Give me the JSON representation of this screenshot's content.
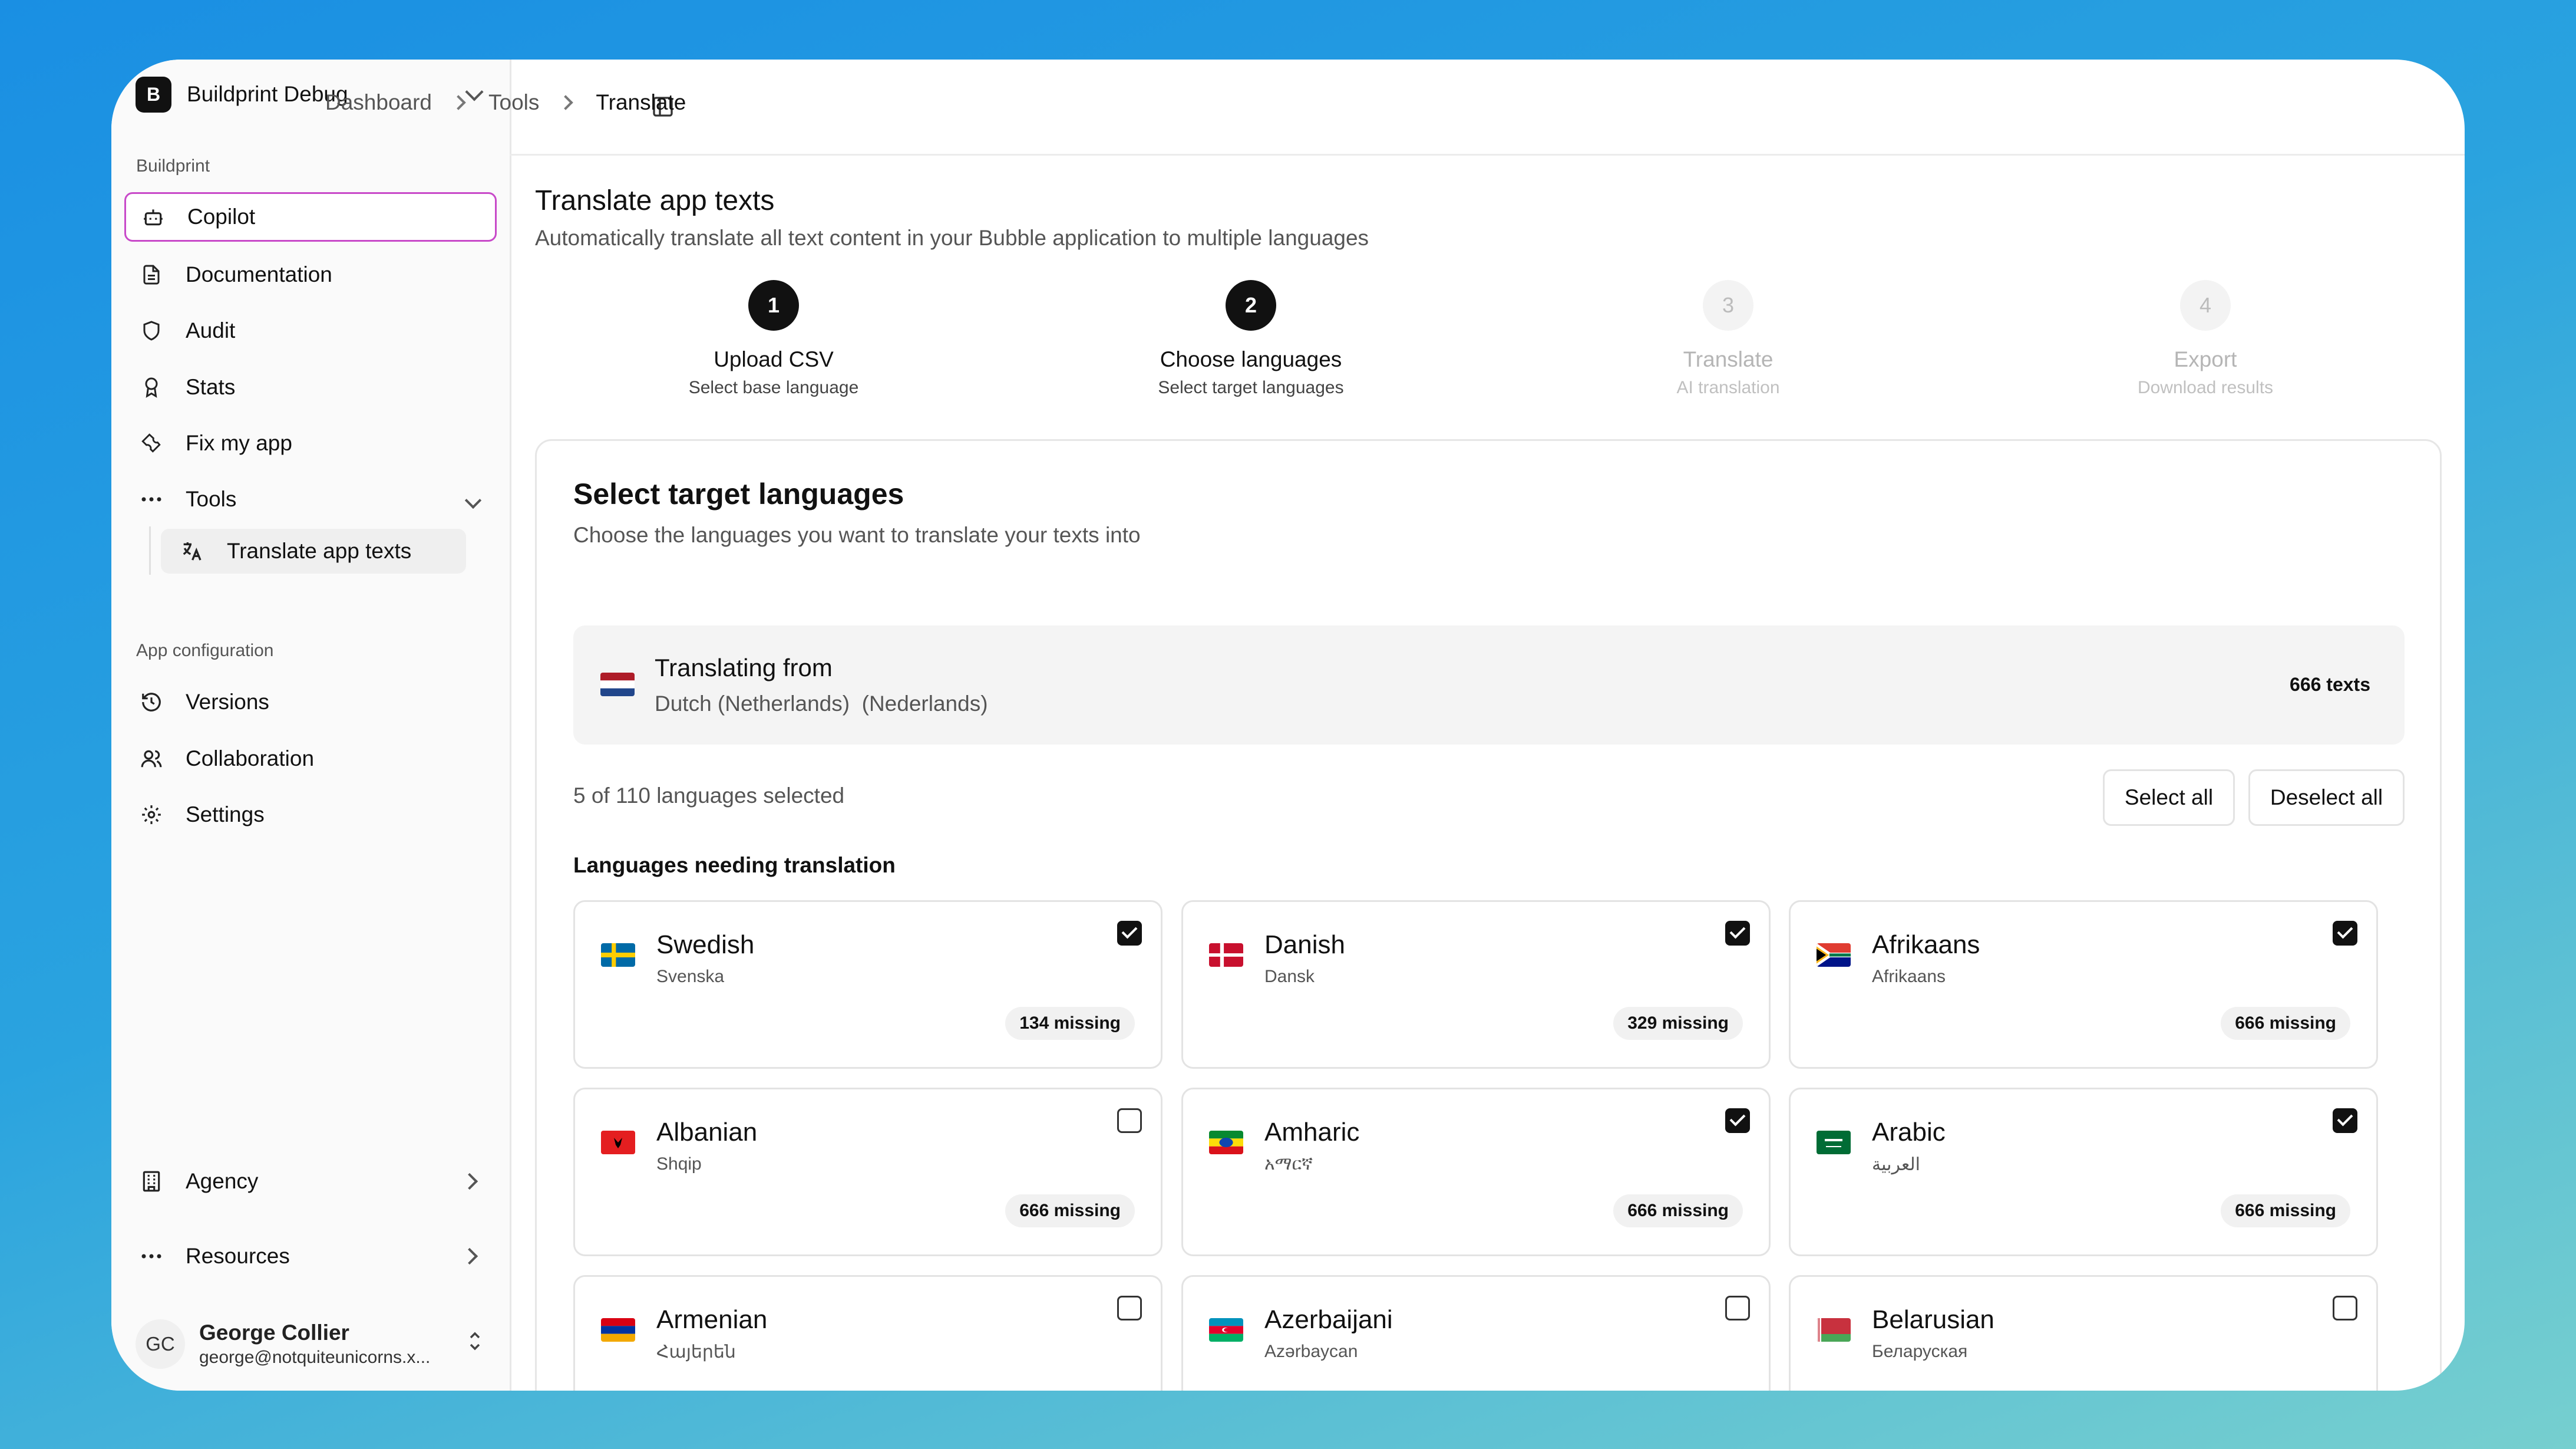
{
  "sidebar": {
    "workspace": {
      "logo_letter": "B",
      "name": "Buildprint Debug"
    },
    "section_buildprint": "Buildprint",
    "items": [
      {
        "label": "Copilot",
        "icon": "robot-icon"
      },
      {
        "label": "Documentation",
        "icon": "document-icon"
      },
      {
        "label": "Audit",
        "icon": "shield-icon"
      },
      {
        "label": "Stats",
        "icon": "award-icon"
      },
      {
        "label": "Fix my app",
        "icon": "wrench-icon"
      },
      {
        "label": "Tools",
        "icon": "more-icon"
      }
    ],
    "sub_item": {
      "label": "Translate app texts",
      "icon": "translate-icon"
    },
    "section_app_config": "App configuration",
    "config_items": [
      {
        "label": "Versions",
        "icon": "history-icon"
      },
      {
        "label": "Collaboration",
        "icon": "users-icon"
      },
      {
        "label": "Settings",
        "icon": "gear-icon"
      }
    ],
    "bottom_items": [
      {
        "label": "Agency",
        "icon": "building-icon"
      },
      {
        "label": "Resources",
        "icon": "more-icon"
      }
    ],
    "user": {
      "initials": "GC",
      "name": "George Collier",
      "email": "george@notquiteunicorns.x..."
    }
  },
  "breadcrumb": {
    "items": [
      "Dashboard",
      "Tools",
      "Translate"
    ]
  },
  "page": {
    "title": "Translate app texts",
    "subtitle": "Automatically translate all text content in your Bubble application to multiple languages"
  },
  "steps": [
    {
      "number": "1",
      "title": "Upload CSV",
      "subtitle": "Select base language",
      "state": "done"
    },
    {
      "number": "2",
      "title": "Choose languages",
      "subtitle": "Select target languages",
      "state": "done"
    },
    {
      "number": "3",
      "title": "Translate",
      "subtitle": "AI translation",
      "state": "todo"
    },
    {
      "number": "4",
      "title": "Export",
      "subtitle": "Download results",
      "state": "todo"
    }
  ],
  "card": {
    "title": "Select target languages",
    "subtitle": "Choose the languages you want to translate your texts into",
    "from": {
      "title": "Translating from",
      "language": "Dutch (Netherlands)  (Nederlands)",
      "count": "666 texts"
    },
    "selected_count": "5 of 110 languages selected",
    "select_all": "Select all",
    "deselect_all": "Deselect all",
    "section_heading": "Languages needing translation",
    "languages": [
      {
        "name": "Swedish",
        "native": "Svenska",
        "missing": "134 missing",
        "checked": true
      },
      {
        "name": "Danish",
        "native": "Dansk",
        "missing": "329 missing",
        "checked": true
      },
      {
        "name": "Afrikaans",
        "native": "Afrikaans",
        "missing": "666 missing",
        "checked": true
      },
      {
        "name": "Albanian",
        "native": "Shqip",
        "missing": "666 missing",
        "checked": false
      },
      {
        "name": "Amharic",
        "native": "አማርኛ",
        "missing": "666 missing",
        "checked": true
      },
      {
        "name": "Arabic",
        "native": "العربية",
        "missing": "666 missing",
        "checked": true
      },
      {
        "name": "Armenian",
        "native": "Հայերեն",
        "missing": "",
        "checked": false
      },
      {
        "name": "Azerbaijani",
        "native": "Azərbaycan",
        "missing": "",
        "checked": false
      },
      {
        "name": "Belarusian",
        "native": "Беларуская",
        "missing": "",
        "checked": false
      }
    ]
  },
  "colors": {
    "active_border": "#c84ac9",
    "step_done": "#111111",
    "step_todo": "#f3f3f3"
  }
}
